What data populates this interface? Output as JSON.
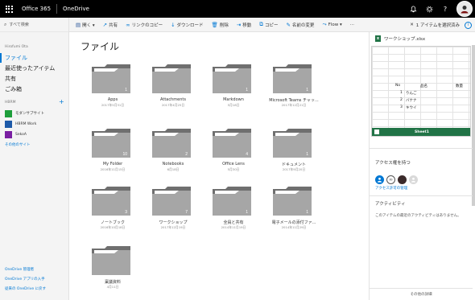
{
  "suite": {
    "brand": "Office 365",
    "app": "OneDrive",
    "notifications_icon": "bell-icon",
    "settings_icon": "gear-icon",
    "help_label": "?"
  },
  "nav": {
    "search_placeholder": "すべて検索",
    "user_name": "Hirofumi Ota",
    "items": [
      {
        "label": "ファイル",
        "active": true
      },
      {
        "label": "最近使ったアイテム"
      },
      {
        "label": "共有"
      },
      {
        "label": "ごみ箱"
      }
    ],
    "sites_title": "HBRM",
    "sites": [
      {
        "label": "モダンサブサイト",
        "color": "#1e9e3b"
      },
      {
        "label": "HBRM Work",
        "color": "#1e5aa8"
      },
      {
        "label": "SekoA",
        "color": "#7a1fa2"
      }
    ],
    "more_sites": "その他のサイト",
    "bottom_links": [
      "OneDrive 管理者",
      "OneDrive アプリの入手",
      "従来の OneDrive に戻す"
    ]
  },
  "commands": {
    "items": [
      {
        "icon": "word-icon",
        "label": "開く ▾"
      },
      {
        "icon": "share-icon",
        "label": "共有"
      },
      {
        "icon": "link-icon",
        "label": "リンクのコピー"
      },
      {
        "icon": "download-icon",
        "label": "ダウンロード"
      },
      {
        "icon": "delete-icon",
        "label": "削除"
      },
      {
        "icon": "move-icon",
        "label": "移動"
      },
      {
        "icon": "copy-icon",
        "label": "コピー"
      },
      {
        "icon": "rename-icon",
        "label": "名前の変更"
      },
      {
        "icon": "flow-icon",
        "label": "Flow ▾"
      },
      {
        "icon": "more-icon",
        "label": "···"
      }
    ],
    "selection_text": "1 アイテムを選択済み"
  },
  "main": {
    "title": "ファイル",
    "tiles": [
      {
        "name": "Apps",
        "date": "2017年5月31日",
        "count": "1"
      },
      {
        "name": "Attachments",
        "date": "2017年4月25日",
        "count": ""
      },
      {
        "name": "Markdown",
        "date": "5月18日",
        "count": "1"
      },
      {
        "name": "Microsoft Teams チャッ...",
        "date": "2017年12月21日",
        "count": "1"
      },
      {
        "name": "My Folder",
        "date": "2016年11月15日",
        "count": "10"
      },
      {
        "name": "Notebooks",
        "date": "6月18日",
        "count": "2"
      },
      {
        "name": "Office Lens",
        "date": "5月30日",
        "count": "4"
      },
      {
        "name": "ドキュメント",
        "date": "2017年9月20日",
        "count": "1"
      },
      {
        "name": "ノートブック",
        "date": "2016年10月18日",
        "count": "3"
      },
      {
        "name": "ワークショップ",
        "date": "2017年12月19日",
        "count": "7"
      },
      {
        "name": "全員と共有",
        "date": "2014年11月19日",
        "count": "1"
      },
      {
        "name": "電子メールの添付ファ...",
        "date": "2014年11月29日",
        "count": "1"
      },
      {
        "name": "稟議資料",
        "date": "4月11日",
        "count": ""
      }
    ]
  },
  "detail": {
    "file_name": "ワークショップ.xlsx",
    "file_icon": "excel-icon",
    "sheet": {
      "headers": [
        "No",
        "品名",
        "数量"
      ],
      "rows": [
        [
          "1",
          "りんご"
        ],
        [
          "2",
          "バナナ"
        ],
        [
          "3",
          "キウイ"
        ]
      ],
      "tab": "Sheet1"
    },
    "access_title": "アクセス権を持つ",
    "access_link": "アクセス許可の管理",
    "activity_title": "アクティビティ",
    "activity_text": "このアイテムの最近のアクティビティはありません。",
    "footer": "その他の詳細"
  }
}
